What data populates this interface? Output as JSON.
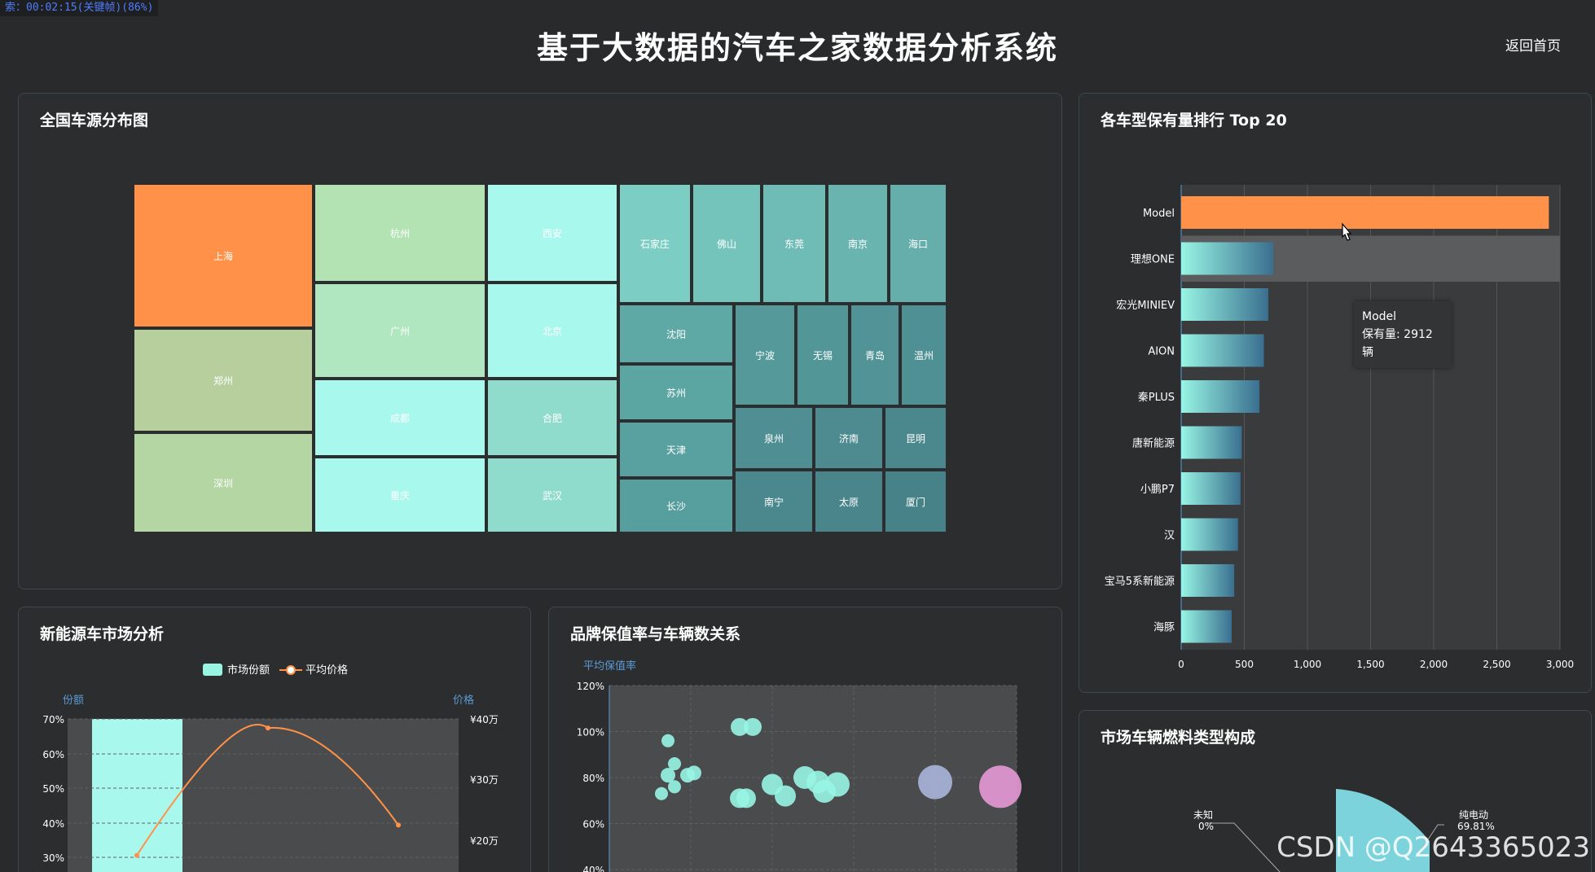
{
  "recorder_text": "索：00:02:15(关键帧)(86%)",
  "header": {
    "title": "基于大数据的汽车之家数据分析系统",
    "home": "返回首页"
  },
  "map_panel": {
    "title": "全国车源分布图",
    "cities": [
      "上海",
      "郑州",
      "深圳",
      "杭州",
      "广州",
      "成都",
      "重庆",
      "西安",
      "北京",
      "合肥",
      "武汉",
      "石家庄",
      "佛山",
      "东莞",
      "南京",
      "海口",
      "沈阳",
      "苏州",
      "天津",
      "长沙",
      "宁波",
      "无锡",
      "青岛",
      "温州",
      "泉州",
      "济南",
      "昆明",
      "南宁",
      "太原",
      "厦门"
    ]
  },
  "rank_panel": {
    "title": "各车型保有量排行 Top 20",
    "tooltip": {
      "name": "Model",
      "value_text": "保有量: 2912辆"
    },
    "chart_data": {
      "type": "bar",
      "orientation": "horizontal",
      "categories": [
        "Model",
        "理想ONE",
        "宏光MINIEV",
        "AION",
        "秦PLUS",
        "唐新能源",
        "小鹏P7",
        "汉",
        "宝马5系新能源",
        "海豚"
      ],
      "values": [
        2912,
        730,
        690,
        655,
        620,
        480,
        470,
        450,
        420,
        400
      ],
      "xlim": [
        0,
        3000
      ],
      "xticks": [
        "0",
        "500",
        "1,000",
        "1,500",
        "2,000",
        "2,500",
        "3,000"
      ],
      "highlight": "Model",
      "colors": {
        "highlight": "#ff9248",
        "bar_start": "#98f5e4",
        "bar_end": "#3a6f8f"
      }
    }
  },
  "ev_panel": {
    "title": "新能源车市场分析",
    "legend": {
      "share": "市场份额",
      "price": "平均价格"
    },
    "chart_data": {
      "type": "bar",
      "left_axis_title": "份额",
      "right_axis_title": "价格",
      "left_ticks": [
        "70%",
        "60%",
        "50%",
        "40%",
        "30%"
      ],
      "right_ticks": [
        "¥40万",
        "¥30万",
        "¥20万"
      ],
      "series": [
        {
          "name": "市场份额",
          "values": [
            70
          ]
        },
        {
          "name": "平均价格",
          "values": [
            17.5,
            38.5,
            22.5
          ]
        }
      ],
      "colors": {
        "bar": "#98f5e4",
        "line": "#ff9248"
      }
    }
  },
  "brand_panel": {
    "title": "品牌保值率与车辆数关系",
    "chart_data": {
      "type": "scatter",
      "y_axis_title": "平均保值率",
      "yticks": [
        "120%",
        "100%",
        "80%",
        "60%",
        "40%"
      ],
      "ylim": [
        40,
        120
      ],
      "points": [
        {
          "x": 0.9,
          "y": 96,
          "r": 8,
          "c": "#98f5e4"
        },
        {
          "x": 1.0,
          "y": 86,
          "r": 8,
          "c": "#98f5e4"
        },
        {
          "x": 0.9,
          "y": 81,
          "r": 9,
          "c": "#98f5e4"
        },
        {
          "x": 1.2,
          "y": 81,
          "r": 9,
          "c": "#98f5e4"
        },
        {
          "x": 1.3,
          "y": 82,
          "r": 9,
          "c": "#98f5e4"
        },
        {
          "x": 1.0,
          "y": 76,
          "r": 8,
          "c": "#98f5e4"
        },
        {
          "x": 0.8,
          "y": 73,
          "r": 8,
          "c": "#98f5e4"
        },
        {
          "x": 2.0,
          "y": 102,
          "r": 11,
          "c": "#98f5e4"
        },
        {
          "x": 2.2,
          "y": 102,
          "r": 11,
          "c": "#98f5e4"
        },
        {
          "x": 2.0,
          "y": 71,
          "r": 12,
          "c": "#98f5e4"
        },
        {
          "x": 2.1,
          "y": 71,
          "r": 12,
          "c": "#98f5e4"
        },
        {
          "x": 2.5,
          "y": 77,
          "r": 13,
          "c": "#98f5e4"
        },
        {
          "x": 2.7,
          "y": 72,
          "r": 13,
          "c": "#98f5e4"
        },
        {
          "x": 3.0,
          "y": 80,
          "r": 14,
          "c": "#98f5e4"
        },
        {
          "x": 3.2,
          "y": 78,
          "r": 14,
          "c": "#98f5e4"
        },
        {
          "x": 3.3,
          "y": 74,
          "r": 14,
          "c": "#98f5e4"
        },
        {
          "x": 3.5,
          "y": 77,
          "r": 15,
          "c": "#98f5e4"
        },
        {
          "x": 5.0,
          "y": 78,
          "r": 21,
          "c": "#a9b5dc"
        },
        {
          "x": 6.0,
          "y": 76,
          "r": 26,
          "c": "#e69ad6"
        }
      ]
    }
  },
  "fuel_panel": {
    "title": "市场车辆燃料类型构成",
    "labels": [
      {
        "name": "未知",
        "pct": "0%"
      },
      {
        "name": "纯电动",
        "pct": "69.81%"
      }
    ]
  },
  "watermark": "CSDN @Q2643365023"
}
